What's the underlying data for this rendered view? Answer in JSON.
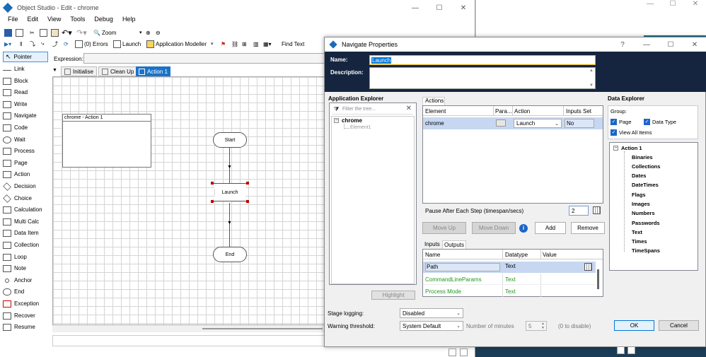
{
  "main_window": {
    "title": "Object Studio - Edit - chrome"
  },
  "menu": [
    "File",
    "Edit",
    "View",
    "Tools",
    "Debug",
    "Help"
  ],
  "toolbar1": {
    "zoom_label": "Zoom"
  },
  "toolbar2": {
    "errors": "(0) Errors",
    "launch": "Launch",
    "app_modeller": "Application Modeller",
    "find_text": "Find Text"
  },
  "expression_label": "Expression:",
  "tools": [
    "Pointer",
    "Link",
    "Block",
    "Read",
    "Write",
    "Navigate",
    "Code",
    "Wait",
    "Process",
    "Page",
    "Action",
    "Decision",
    "Choice",
    "Calculation",
    "Multi Calc",
    "Data Item",
    "Collection",
    "Loop",
    "Note",
    "Anchor",
    "End",
    "Exception",
    "Recover",
    "Resume"
  ],
  "page_tabs": [
    "Initialise",
    "Clean Up",
    "Action 1"
  ],
  "canvas": {
    "block_label": "chrome - Action 1",
    "start": "Start",
    "launch": "Launch",
    "end": "End"
  },
  "dialog": {
    "title": "Navigate Properties",
    "help": "?",
    "name_label": "Name:",
    "name_value": "Launch",
    "description_label": "Description:",
    "app_explorer": {
      "title": "Application Explorer",
      "filter_placeholder": "Filter the tree...",
      "root": "chrome",
      "child": "Element1",
      "highlight": "Highlight"
    },
    "actions": {
      "tab": "Actions",
      "columns": [
        "Element",
        "Para...",
        "Action",
        "Inputs Set"
      ],
      "row": {
        "element": "chrome",
        "action": "Launch",
        "inputs_set": "No"
      },
      "pause_label": "Pause After Each Step (timespan/secs)",
      "pause_value": "2",
      "move_up": "Move Up",
      "move_down": "Move Down",
      "add": "Add",
      "remove": "Remove"
    },
    "io": {
      "tabs": [
        "Inputs",
        "Outputs"
      ],
      "columns": [
        "Name",
        "Datatype",
        "Value"
      ],
      "rows": [
        {
          "name": "Path",
          "datatype": "Text"
        },
        {
          "name": "CommandLineParams",
          "datatype": "Text"
        },
        {
          "name": "Process Mode",
          "datatype": "Text"
        }
      ]
    },
    "data_explorer": {
      "title": "Data Explorer",
      "group_label": "Group:",
      "page": "Page",
      "data_type": "Data Type",
      "view_all": "View All Items",
      "root": "Action 1",
      "items": [
        "Binaries",
        "Collections",
        "Dates",
        "DateTimes",
        "Flags",
        "Images",
        "Numbers",
        "Passwords",
        "Text",
        "Times",
        "TimeSpans"
      ]
    },
    "stage_logging_label": "Stage logging:",
    "stage_logging_value": "Disabled",
    "warning_label": "Warning threshold:",
    "warning_value": "System Default",
    "minutes_label": "Number of minutes",
    "minutes_value": "5",
    "minutes_hint": "(0 to disable)",
    "ok": "OK",
    "cancel": "Cancel"
  },
  "colors": {
    "dialog_header": "#15253f",
    "accent": "#0078d7",
    "selected_row": "#c7d7f1",
    "green_text": "#1e9a1e"
  }
}
